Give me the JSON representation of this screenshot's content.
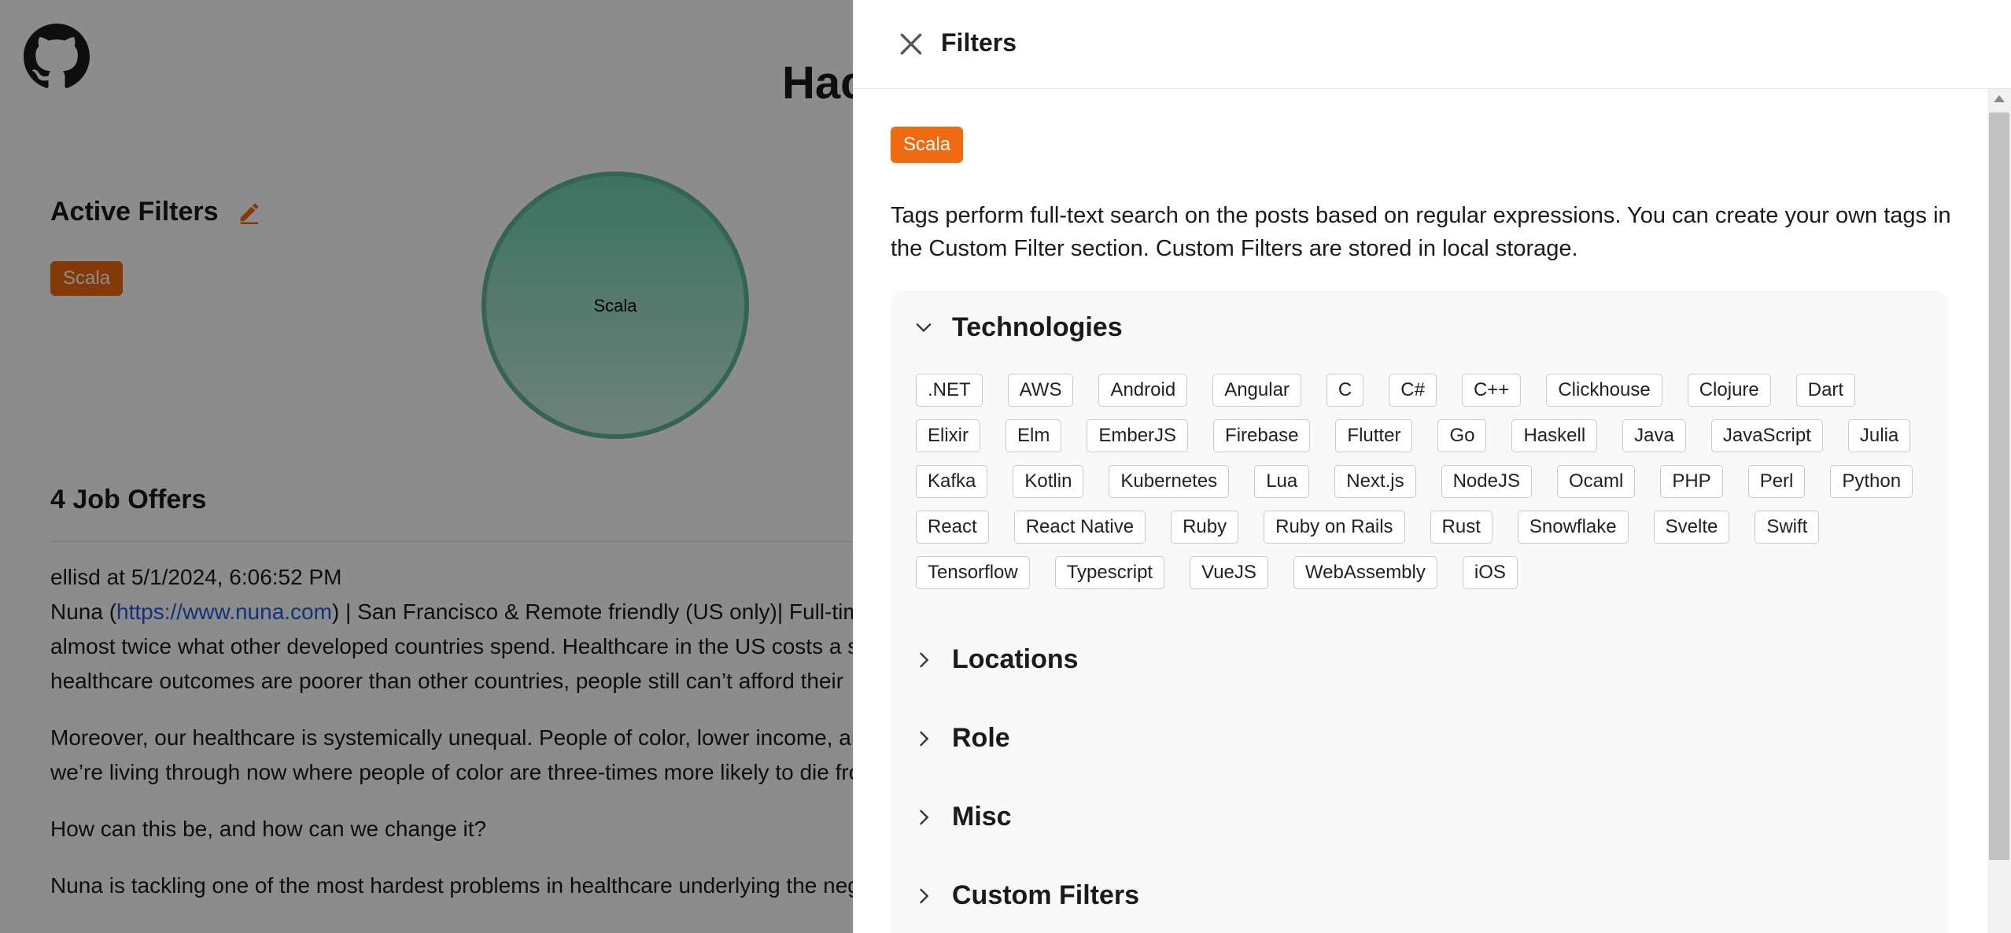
{
  "page": {
    "title": "Hacker News Jobs",
    "active_filters_title": "Active Filters",
    "active_filter_chips": [
      "Scala"
    ],
    "bubble_label": "Scala",
    "job_count_title": "4 Job Offers",
    "post": {
      "author_line": "ellisd at 5/1/2024, 6:06:52 PM",
      "company_prefix": "Nuna (",
      "company_link": "https://www.nuna.com",
      "line1_rest": ") | San Francisco & Remote friendly (US only)| Full-time",
      "line2": "almost twice what other developed countries spend. Healthcare in the US costs a s",
      "line3": "healthcare outcomes are poorer than other countries, people still can’t afford their",
      "para2_line1": "Moreover, our healthcare is systemically unequal. People of color, lower income, ar",
      "para2_line2": "we’re living through now where people of color are three-times more likely to die fro",
      "para3": "How can this be, and how can we change it?",
      "para4": "Nuna is tackling one of the most hardest problems in healthcare underlying the neg"
    }
  },
  "drawer": {
    "title": "Filters",
    "selected_chip": "Scala",
    "description": "Tags perform full-text search on the posts based on regular expressions. You can create your own tags in the Custom Filter section. Custom Filters are stored in local storage.",
    "sections": [
      {
        "label": "Technologies",
        "expanded": true,
        "tags": [
          ".NET",
          "AWS",
          "Android",
          "Angular",
          "C",
          "C#",
          "C++",
          "Clickhouse",
          "Clojure",
          "Dart",
          "Elixir",
          "Elm",
          "EmberJS",
          "Firebase",
          "Flutter",
          "Go",
          "Haskell",
          "Java",
          "JavaScript",
          "Julia",
          "Kafka",
          "Kotlin",
          "Kubernetes",
          "Lua",
          "Next.js",
          "NodeJS",
          "Ocaml",
          "PHP",
          "Perl",
          "Python",
          "React",
          "React Native",
          "Ruby",
          "Ruby on Rails",
          "Rust",
          "Snowflake",
          "Svelte",
          "Swift",
          "Tensorflow",
          "Typescript",
          "VueJS",
          "WebAssembly",
          "iOS"
        ]
      },
      {
        "label": "Locations",
        "expanded": false
      },
      {
        "label": "Role",
        "expanded": false
      },
      {
        "label": "Misc",
        "expanded": false
      },
      {
        "label": "Custom Filters",
        "expanded": false
      }
    ]
  },
  "colors": {
    "accent_orange": "#f06a0f",
    "bubble_teal": "#6fd1b0",
    "link_blue": "#1a5fd9",
    "overlay": "rgba(0,0,0,0.45)"
  },
  "icons": {
    "logo": "github-icon",
    "edit": "pencil-icon",
    "close": "close-icon",
    "expanded": "chevron-down-icon",
    "collapsed": "chevron-right-icon"
  }
}
